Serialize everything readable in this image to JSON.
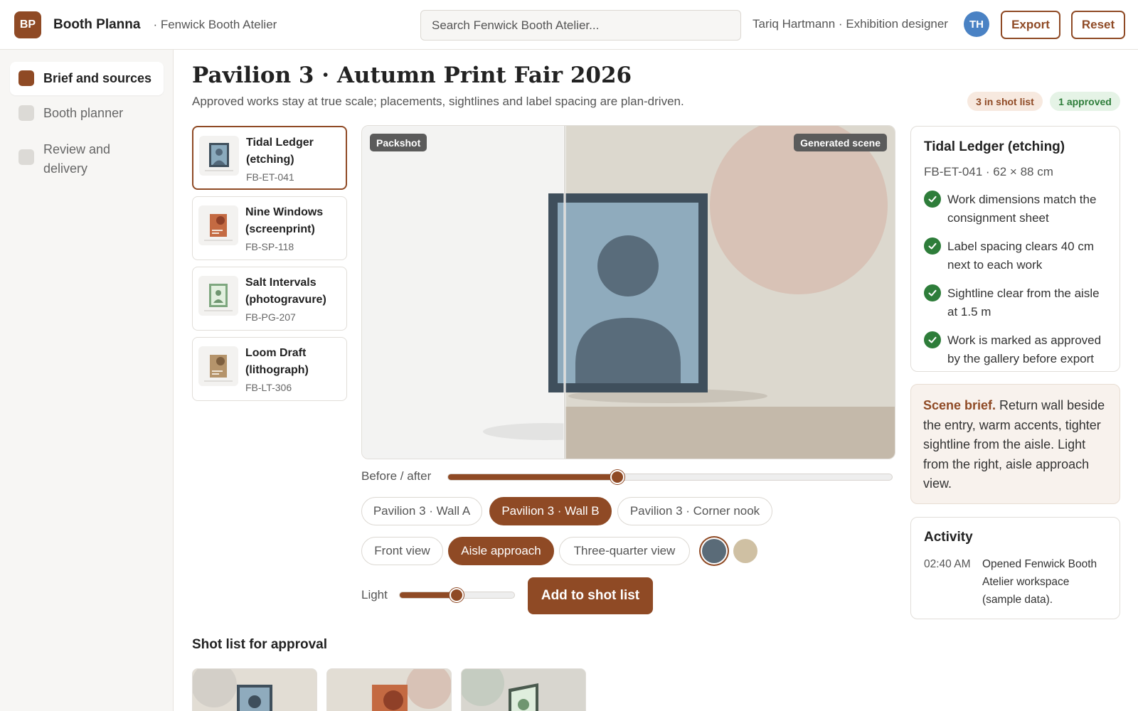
{
  "header": {
    "logo_text": "BP",
    "app_name": "Booth Planna",
    "workspace": "· Fenwick Booth Atelier",
    "search_placeholder": "Search Fenwick Booth Atelier...",
    "user_label": "Tariq Hartmann · Exhibition designer",
    "avatar_initials": "TH",
    "export_label": "Export",
    "reset_label": "Reset"
  },
  "sidebar": {
    "items": [
      {
        "label": "Brief and sources",
        "active": true
      },
      {
        "label": "Booth planner",
        "active": false
      },
      {
        "label": "Review and delivery",
        "active": false
      }
    ]
  },
  "page": {
    "title": "Pavilion 3 · Autumn Print Fair 2026",
    "subtitle": "Approved works stay at true scale; placements, sightlines and label spacing are plan-driven.",
    "badge_shot_list": "3 in shot list",
    "badge_approved": "1 approved"
  },
  "works": [
    {
      "name": "Tidal Ledger (etching)",
      "code": "FB-ET-041",
      "thumb": "portrait-blue-icon"
    },
    {
      "name": "Nine Windows (screenprint)",
      "code": "FB-SP-118",
      "thumb": "print-orange-icon"
    },
    {
      "name": "Salt Intervals (photogravure)",
      "code": "FB-PG-207",
      "thumb": "portrait-green-icon"
    },
    {
      "name": "Loom Draft (lithograph)",
      "code": "FB-LT-306",
      "thumb": "print-tan-icon"
    }
  ],
  "stage": {
    "packshot_label": "Packshot",
    "generated_label": "Generated scene",
    "before_after_label": "Before / after",
    "before_after_value": 0.38,
    "light_label": "Light",
    "light_value": 0.49
  },
  "walls": [
    {
      "label": "Pavilion 3 · Wall A",
      "active": false
    },
    {
      "label": "Pavilion 3 · Wall B",
      "active": true
    },
    {
      "label": "Pavilion 3 · Corner nook",
      "active": false
    }
  ],
  "views": [
    {
      "label": "Front view",
      "active": false
    },
    {
      "label": "Aisle approach",
      "active": true
    },
    {
      "label": "Three-quarter view",
      "active": false
    }
  ],
  "swatches": [
    {
      "color": "#5a6b78",
      "selected": true
    },
    {
      "color": "#cfc0a3",
      "selected": false
    }
  ],
  "add_button_label": "Add to shot list",
  "shot_list_title": "Shot list for approval",
  "detail": {
    "title": "Tidal Ledger (etching)",
    "subtitle": "FB-ET-041 · 62 × 88 cm",
    "checks": [
      "Work dimensions match the consignment sheet",
      "Label spacing clears 40 cm next to each work",
      "Sightline clear from the aisle at 1.5 m",
      "Work is marked as approved by the gallery before export"
    ]
  },
  "brief": {
    "lead": "Scene brief.",
    "text": " Return wall beside the entry, warm accents, tighter sightline from the aisle. Light from the right, aisle approach view."
  },
  "activity": {
    "title": "Activity",
    "entries": [
      {
        "time": "02:40 AM",
        "text": "Opened Fenwick Booth Atelier workspace (sample data)."
      }
    ]
  },
  "colors": {
    "accent": "#8f4a25",
    "success": "#2e7d3a",
    "avatar": "#4a82c4"
  }
}
